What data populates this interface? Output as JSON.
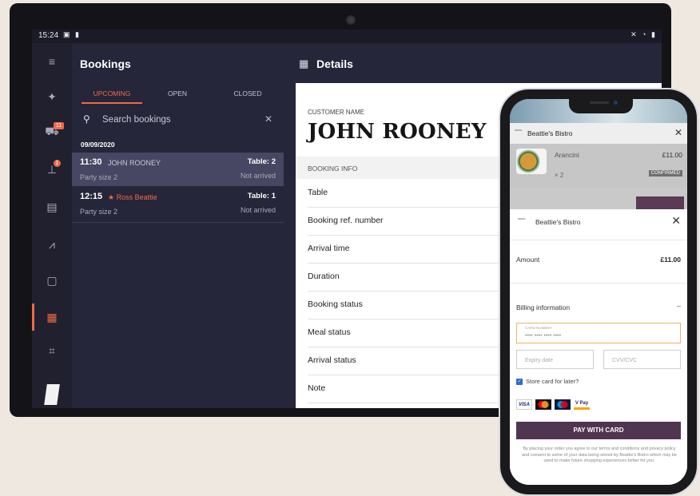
{
  "status_bar": {
    "time": "15:24"
  },
  "rail": {
    "items": [
      {
        "name": "menu-icon",
        "glyph": "≡"
      },
      {
        "name": "android-icon",
        "glyph": "✦"
      },
      {
        "name": "cart-icon",
        "glyph": "🛒",
        "badge": "11"
      },
      {
        "name": "pin-icon",
        "glyph": "⚲",
        "badge": "1"
      },
      {
        "name": "list-icon",
        "glyph": "▤"
      },
      {
        "name": "analytics-icon",
        "glyph": "📈"
      },
      {
        "name": "inbox-icon",
        "glyph": "▢"
      },
      {
        "name": "calendar-icon",
        "glyph": "📅",
        "active": true
      },
      {
        "name": "qr-scan-icon",
        "glyph": "⌗"
      }
    ]
  },
  "bookings": {
    "title": "Bookings",
    "tabs": [
      "UPCOMING",
      "OPEN",
      "CLOSED"
    ],
    "active_tab": "UPCOMING",
    "search_placeholder": "Search bookings",
    "date": "09/09/2020",
    "rows": [
      {
        "time": "11:30",
        "name": "JOHN ROONEY",
        "table": "Table: 2",
        "party": "Party size 2",
        "status": "Not arrived",
        "selected": true,
        "vip": false
      },
      {
        "time": "12:15",
        "name": "★ Ross  Beattie",
        "table": "Table: 1",
        "party": "Party size 2",
        "status": "Not arrived",
        "selected": false,
        "vip": true
      }
    ]
  },
  "details": {
    "title": "Details",
    "customer_label": "CUSTOMER NAME",
    "customer_name": "JOHN ROONEY",
    "booking_info_label": "BOOKING INFO",
    "fields": [
      "Table",
      "Booking ref. number",
      "Arrival time",
      "Duration",
      "Booking status",
      "Meal status",
      "Arrival status",
      "Note"
    ]
  },
  "phone": {
    "header_brand": "Beattie's Bistro",
    "item": {
      "name": "Arancini",
      "price": "£11.00",
      "qty": "× 2",
      "badge": "CONFIRMED"
    },
    "sheet": {
      "brand": "Beattie's Bistro",
      "amount_label": "Amount",
      "amount": "£11.00",
      "billing_label": "Billing information",
      "card_label": "CARD NUMBER",
      "card_placeholder": "•••• •••• •••• ••••",
      "expiry_placeholder": "Expiry date",
      "cvv_placeholder": "CVV/CVC",
      "store_card": "Store card for later?",
      "card_brands": [
        "VISA",
        "",
        "",
        "V Pay"
      ],
      "pay_button": "PAY WITH CARD",
      "legal": "By placing your order you agree to our terms and conditions and privacy policy and consent to some of your data being stored by Beattie's Bistro which may be used to make future shopping experiences better for you."
    }
  },
  "colors": {
    "accent": "#f06a45",
    "panel": "#26263a",
    "pay_button": "#4f3550"
  }
}
